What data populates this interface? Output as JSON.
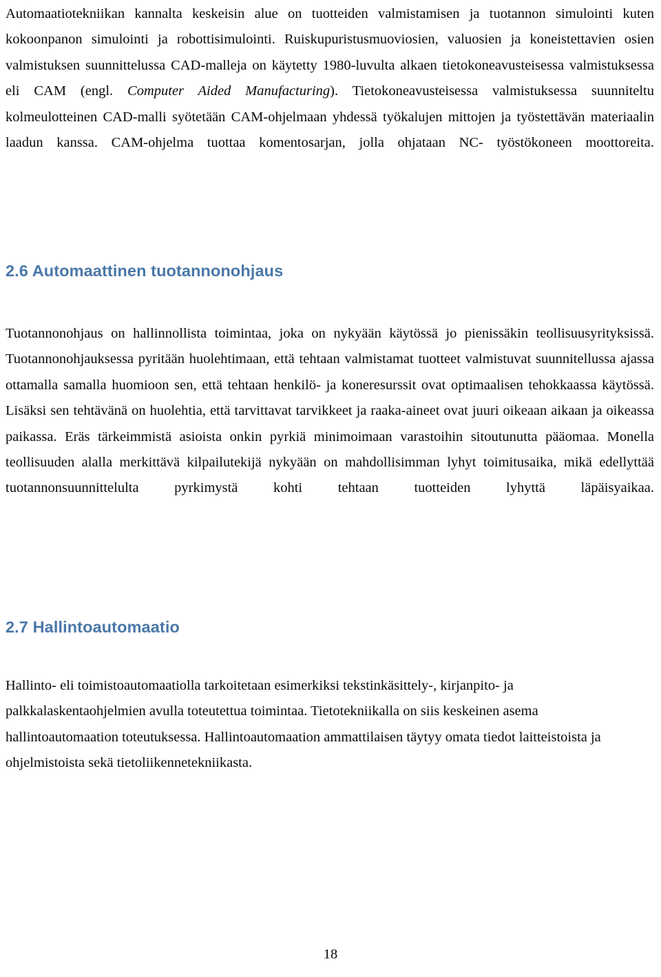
{
  "document": {
    "language": "fi",
    "page_number": "18",
    "heading_color": "#4A77A8",
    "body_color": "#0a0a0a"
  },
  "content": {
    "intro_paragraph": {
      "text_before_italic": "Automaatiotekniikan kannalta keskeisin alue on tuotteiden valmistamisen ja tuotannon simulointi kuten kokoonpanon simulointi ja robottisimulointi. Ruiskupuristusmuoviosien, valuosien ja koneistettavien osien valmistuksen suunnittelussa CAD-malleja on käytetty 1980-luvulta alkaen tietokoneavusteisessa valmistuksessa eli CAM (engl. ",
      "italic_text": "Computer Aided Manufacturing",
      "text_after_italic": "). Tietokoneavusteisessa valmistuksessa suunniteltu kolmeulotteinen CAD-malli syötetään CAM-ohjelmaan yhdessä työkalujen mittojen ja työstettävän materiaalin laadun kanssa. CAM-ohjelma tuottaa komentosarjan, jolla ohjataan NC- työstökoneen moottoreita."
    },
    "section_26": {
      "heading": "2.6 Automaattinen tuotannonohjaus",
      "paragraph": "Tuotannonohjaus on hallinnollista toimintaa, joka on nykyään käytössä jo pienissäkin teollisuusyrityksissä. Tuotannonohjauksessa pyritään huolehtimaan, että tehtaan valmistamat tuotteet valmistuvat suunnitellussa ajassa ottamalla samalla huomioon sen, että tehtaan henkilö- ja koneresurssit ovat optimaalisen tehokkaassa käytössä. Lisäksi sen tehtävänä on huolehtia, että tarvittavat tarvikkeet ja raaka-aineet ovat juuri oikeaan aikaan ja oikeassa paikassa. Eräs tärkeimmistä asioista onkin pyrkiä minimoimaan varastoihin sitoutunutta pääomaa. Monella teollisuuden alalla merkittävä kilpailutekijä nykyään on mahdollisimman lyhyt toimitusaika, mikä edellyttää tuotannonsuunnittelulta pyrkimystä kohti tehtaan tuotteiden lyhyttä läpäisyaikaa."
    },
    "section_27": {
      "heading": "2.7 Hallintoautomaatio",
      "paragraph": "Hallinto- eli toimistoautomaatiolla tarkoitetaan esimerkiksi tekstinkäsittely-, kirjanpito- ja palkkalaskentaohjelmien avulla toteutettua toimintaa. Tietotekniikalla on siis keskeinen asema hallintoautomaation toteutuksessa. Hallintoautomaation ammattilaisen täytyy omata tiedot laitteistoista ja ohjelmistoista sekä tietoliikennetekniikasta."
    },
    "footer": {
      "page_number": "18"
    }
  }
}
